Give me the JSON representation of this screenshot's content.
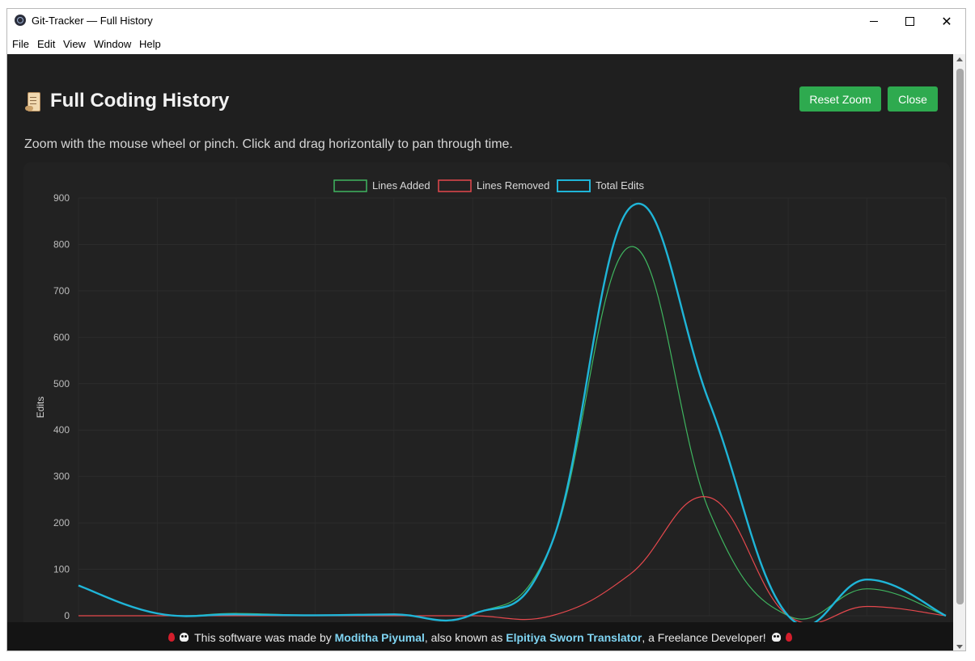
{
  "window": {
    "title": "Git-Tracker — Full History",
    "minimize_glyph": "",
    "close_glyph": "✕"
  },
  "menu": [
    "File",
    "Edit",
    "View",
    "Window",
    "Help"
  ],
  "page": {
    "heading": "Full Coding History",
    "heading_icon": "scroll-icon",
    "hint": "Zoom with the mouse wheel or pinch. Click and drag horizontally to pan through time.",
    "reset_zoom_label": "Reset Zoom",
    "close_label": "Close",
    "accent_color": "#2eaa4f"
  },
  "footer": {
    "prefix": " This software was made by ",
    "author": "Moditha Piyumal",
    "middle": ", also known as ",
    "alias": "Elpitiya Sworn Translator",
    "suffix": ", a Freelance Developer! ",
    "highlight_color": "#7fd4f2"
  },
  "chart_data": {
    "type": "line",
    "ylabel": "Edits",
    "ylim": [
      0,
      900
    ],
    "yticks": [
      0,
      100,
      200,
      300,
      400,
      500,
      600,
      700,
      800,
      900
    ],
    "grid": true,
    "legend_position": "top",
    "x_index": [
      0,
      1,
      2,
      3,
      4,
      5,
      6,
      7,
      8,
      9,
      10,
      11
    ],
    "series": [
      {
        "name": "Lines Added",
        "color": "#3fb55f",
        "values": [
          65,
          5,
          5,
          1,
          3,
          3,
          155,
          795,
          225,
          0,
          58,
          0
        ]
      },
      {
        "name": "Lines Removed",
        "color": "#e5484d",
        "values": [
          0,
          0,
          0,
          0,
          0,
          0,
          0,
          90,
          255,
          0,
          20,
          0
        ]
      },
      {
        "name": "Total Edits",
        "color": "#1fb5d8",
        "values": [
          65,
          5,
          3,
          1,
          3,
          3,
          155,
          880,
          460,
          0,
          78,
          0
        ]
      }
    ]
  }
}
